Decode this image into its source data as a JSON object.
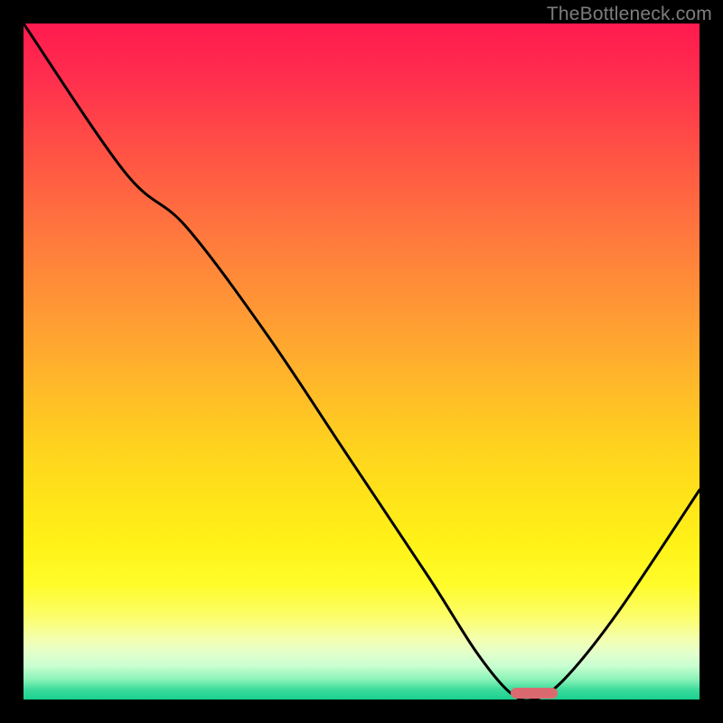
{
  "watermark": "TheBottleneck.com",
  "chart_data": {
    "type": "line",
    "title": "",
    "xlabel": "",
    "ylabel": "",
    "xlim": [
      0,
      100
    ],
    "ylim": [
      0,
      100
    ],
    "grid": false,
    "legend": false,
    "series": [
      {
        "name": "bottleneck-curve",
        "x": [
          0,
          15,
          24,
          36,
          48,
          60,
          67,
          72,
          75.5,
          80,
          88,
          100
        ],
        "values": [
          100,
          78,
          70,
          54,
          36,
          18,
          7,
          1,
          0,
          3,
          13,
          31
        ]
      }
    ],
    "marker": {
      "shape": "lozenge",
      "x_center_pct": 75.5,
      "width_pct": 6.9,
      "height_pct": 1.6,
      "color": "#da6a6f"
    },
    "background_gradient_stops": [
      {
        "pct": 0,
        "color": "#ff1a4f"
      },
      {
        "pct": 50,
        "color": "#ffbf23"
      },
      {
        "pct": 85,
        "color": "#fffd52"
      },
      {
        "pct": 100,
        "color": "#18d08e"
      }
    ]
  }
}
